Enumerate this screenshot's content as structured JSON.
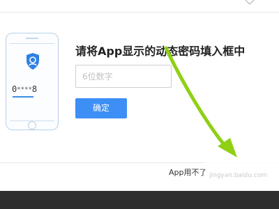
{
  "dialog": {
    "close_icon": "close-icon",
    "prompt": "请将App显示的动态密码填入框中",
    "code_input": {
      "placeholder": "6位数字",
      "value": ""
    },
    "confirm_label": "确定",
    "help_link": "App用不了"
  },
  "phone_illustration": {
    "icon": "shield-person-icon",
    "code_first": "0",
    "code_masked": "****",
    "code_last": "8"
  },
  "watermark": "jingyan.baidu.com",
  "colors": {
    "accent": "#3d8ff5",
    "arrow": "#8fd014",
    "footer": "#2e2e2e"
  }
}
